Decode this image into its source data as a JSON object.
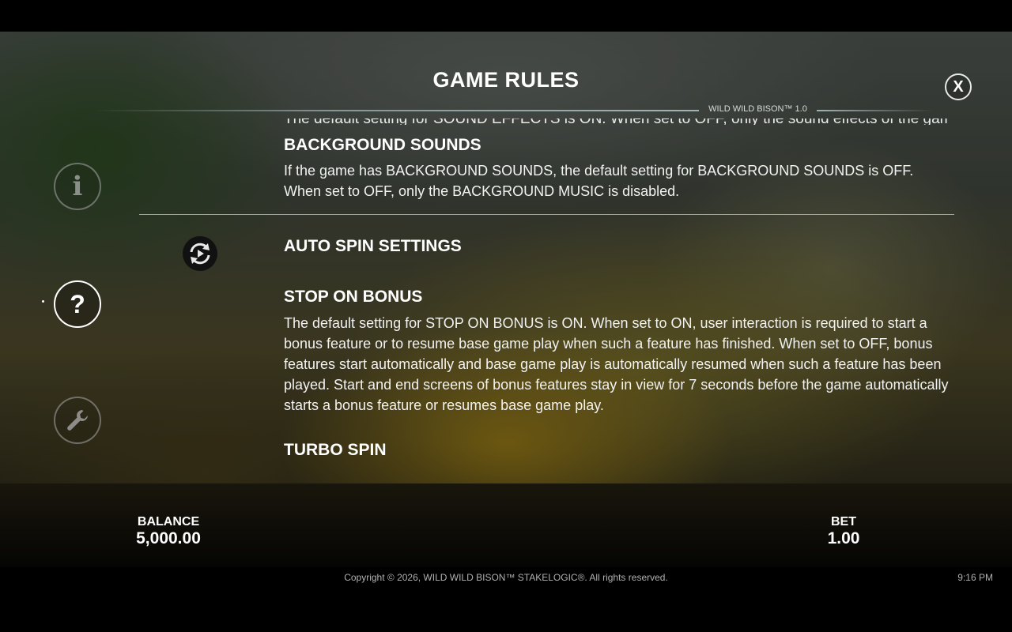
{
  "header": {
    "title": "GAME RULES",
    "version": "WILD WILD BISON™ 1.0",
    "close_label": "X"
  },
  "sidebar": {
    "items": [
      {
        "name": "info",
        "glyph": "i",
        "active": false
      },
      {
        "name": "help",
        "glyph": "?",
        "active": true
      },
      {
        "name": "settings",
        "glyph": "wrench-icon",
        "active": false
      }
    ]
  },
  "rules": {
    "cut_off_line": "The default setting for SOUND EFFECTS is ON. When set to OFF, only the sound effects of the game are disabled.",
    "background_sounds": {
      "heading": "BACKGROUND SOUNDS",
      "text": "If the game has BACKGROUND SOUNDS, the default setting for BACKGROUND SOUNDS is OFF. When set to OFF, only the BACKGROUND MUSIC is disabled."
    },
    "auto_spin_settings": {
      "heading": "AUTO SPIN SETTINGS",
      "icon": "auto-spin-icon"
    },
    "stop_on_bonus": {
      "heading": "STOP ON BONUS",
      "text": "The default setting for STOP ON BONUS is ON. When set to ON, user interaction is required to start a bonus feature or to resume base game play when such a feature has finished. When set to OFF, bonus features start automatically and base game play is automatically resumed when such a feature has been played. Start and end screens of bonus features stay in view for 7 seconds before the game automatically starts a bonus feature or resumes base game play."
    },
    "turbo_spin": {
      "heading": "TURBO SPIN"
    }
  },
  "status": {
    "balance_label": "BALANCE",
    "balance_value": "5,000.00",
    "bet_label": "BET",
    "bet_value": "1.00"
  },
  "footer": {
    "copyright": "Copyright © 2026, WILD WILD BISON™ STAKELOGIC®. All rights reserved.",
    "time": "9:16 PM"
  }
}
